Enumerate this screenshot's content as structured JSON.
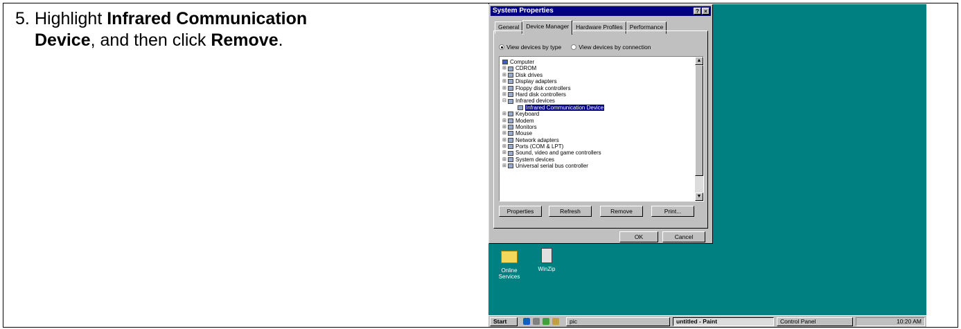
{
  "instruction": {
    "number": "5.",
    "line1_prefix": "Highlight ",
    "line1_bold": "Infrared Communication",
    "line2_bold": "Device",
    "line2_mid": ", and then click ",
    "line2_bold2": "Remove",
    "line2_end": "."
  },
  "window": {
    "title": "System Properties",
    "help_btn": "?",
    "close_btn": "×",
    "tabs": [
      "General",
      "Device Manager",
      "Hardware Profiles",
      "Performance"
    ],
    "active_tab": 1,
    "radio_type": "View devices by type",
    "radio_connection": "View devices by connection",
    "tree": [
      {
        "label": "Computer",
        "kind": "root"
      },
      {
        "label": "CDROM",
        "kind": "node"
      },
      {
        "label": "Disk drives",
        "kind": "node"
      },
      {
        "label": "Display adapters",
        "kind": "node"
      },
      {
        "label": "Floppy disk controllers",
        "kind": "node"
      },
      {
        "label": "Hard disk controllers",
        "kind": "node"
      },
      {
        "label": "Infrared devices",
        "kind": "open"
      },
      {
        "label": "Infrared Communication Device",
        "kind": "child-selected"
      },
      {
        "label": "Keyboard",
        "kind": "node"
      },
      {
        "label": "Modem",
        "kind": "node"
      },
      {
        "label": "Monitors",
        "kind": "node"
      },
      {
        "label": "Mouse",
        "kind": "node"
      },
      {
        "label": "Network adapters",
        "kind": "node"
      },
      {
        "label": "Ports (COM & LPT)",
        "kind": "node"
      },
      {
        "label": "Sound, video and game controllers",
        "kind": "node"
      },
      {
        "label": "System devices",
        "kind": "node"
      },
      {
        "label": "Universal serial bus controller",
        "kind": "node"
      }
    ],
    "buttons": {
      "properties": "Properties",
      "refresh": "Refresh",
      "remove": "Remove",
      "print": "Print...",
      "ok": "OK",
      "cancel": "Cancel"
    }
  },
  "desktop_icons": {
    "online": "Online Services",
    "winzip": "WinZip"
  },
  "taskbar": {
    "start": "Start",
    "pic": "pic",
    "paint": "untitled - Paint",
    "control_panel": "Control Panel",
    "clock": "10:20 AM"
  },
  "colors": {
    "desktop": "#008080",
    "titlebar": "#000080",
    "selection": "#000080"
  }
}
